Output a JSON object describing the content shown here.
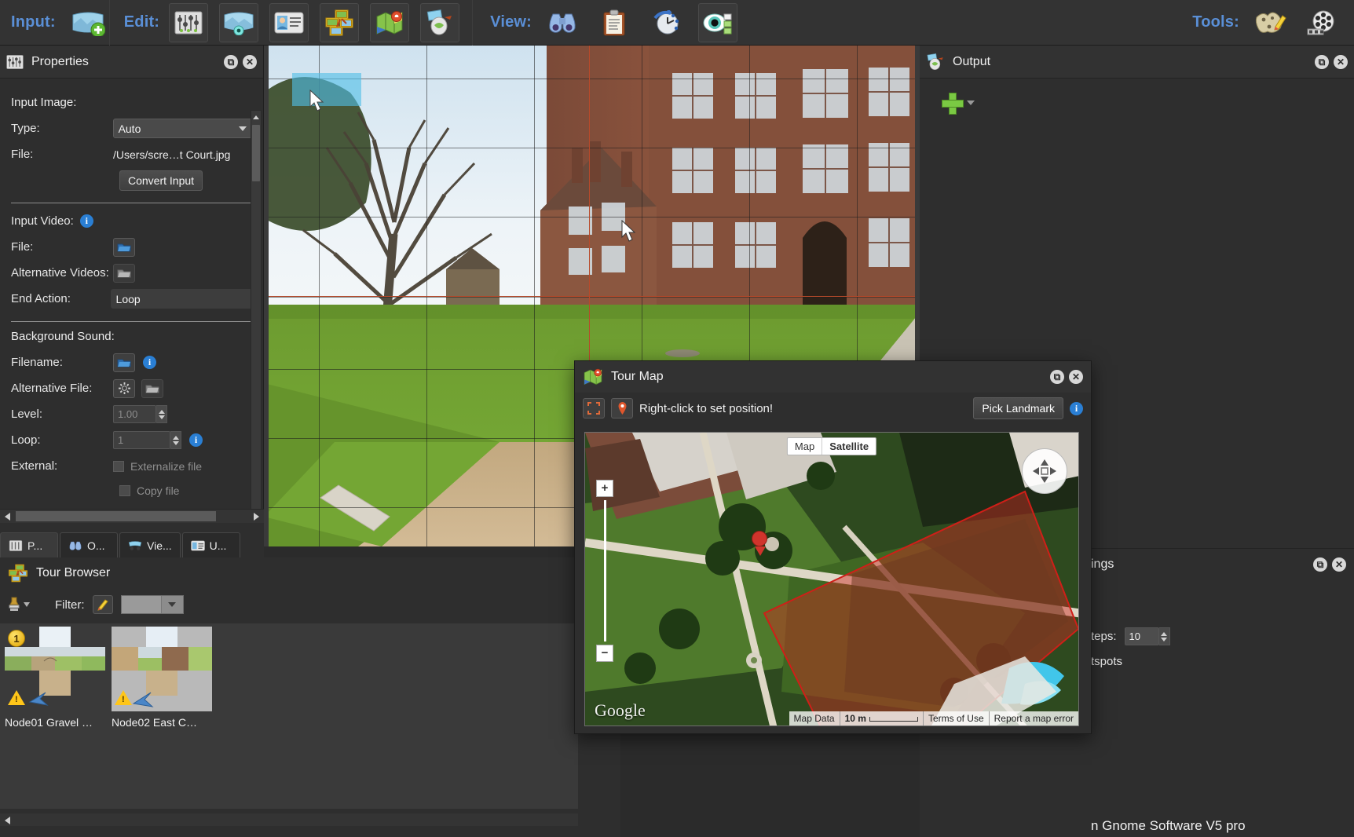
{
  "toolbar": {
    "input_label": "Input:",
    "edit_label": "Edit:",
    "view_label": "View:",
    "tools_label": "Tools:",
    "input_buttons": [
      {
        "name": "add-input-panorama-icon",
        "glyph": "🏞"
      }
    ],
    "edit_buttons": [
      {
        "name": "properties-sliders-icon",
        "glyph": "🎚"
      },
      {
        "name": "panorama-viewer-icon",
        "glyph": "🌅"
      },
      {
        "name": "user-data-card-icon",
        "glyph": "📇"
      },
      {
        "name": "tour-browser-icon",
        "glyph": "🖼"
      },
      {
        "name": "tour-map-icon",
        "glyph": "🗺"
      },
      {
        "name": "output-tree-icon",
        "glyph": "🌳"
      }
    ],
    "view_buttons": [
      {
        "name": "binoculars-icon",
        "glyph": "🔭"
      },
      {
        "name": "clipboard-icon",
        "glyph": "📋"
      },
      {
        "name": "history-clock-icon",
        "glyph": "🕓"
      },
      {
        "name": "preview-eye-icon",
        "glyph": "👁"
      }
    ],
    "tools_buttons": [
      {
        "name": "map-edit-icon",
        "glyph": "🗺"
      },
      {
        "name": "film-reel-icon",
        "glyph": "🎥"
      }
    ]
  },
  "properties": {
    "title": "Properties",
    "restore_label": "⧉",
    "close_label": "✕",
    "groups": {
      "input_image": {
        "heading": "Input Image:",
        "type_label": "Type:",
        "type_value": "Auto",
        "file_label": "File:",
        "file_value": "/Users/scre…t Court.jpg",
        "convert_button": "Convert Input"
      },
      "input_video": {
        "heading": "Input Video:",
        "file_label": "File:",
        "alt_videos_label": "Alternative Videos:",
        "end_action_label": "End Action:",
        "end_action_value": "Loop"
      },
      "background_sound": {
        "heading": "Background Sound:",
        "filename_label": "Filename:",
        "alt_file_label": "Alternative File:",
        "level_label": "Level:",
        "level_value": "1.00",
        "loop_label": "Loop:",
        "loop_value": "1",
        "external_label": "External:",
        "externalize_checkbox": "Externalize file",
        "copy_checkbox": "Copy file"
      }
    },
    "tabs": [
      {
        "label": "P...",
        "icon": "properties-sliders-icon",
        "active": true
      },
      {
        "label": "O...",
        "icon": "binoculars-icon",
        "active": false
      },
      {
        "label": "Vie...",
        "icon": "viewer-icon",
        "active": false
      },
      {
        "label": "U...",
        "icon": "user-data-card-icon",
        "active": false
      }
    ]
  },
  "tour_browser": {
    "title": "Tour Browser",
    "filter_label": "Filter:",
    "filter_value": "",
    "nodes": [
      {
        "number": "1",
        "caption": "Node01 Gravel …",
        "selected": false,
        "warning": true
      },
      {
        "number": "",
        "caption": "Node02 East C…",
        "selected": true,
        "warning": true
      }
    ]
  },
  "viewport": {
    "image_description": "Panoramic photo of a red-brick Tudor manor house with lawn and gravel path",
    "hotspot_name": "panorama-hotspot"
  },
  "output": {
    "title": "Output",
    "add_label": "+",
    "restore_label": "⧉",
    "close_label": "✕"
  },
  "settings_panel": {
    "title_visible": "ings",
    "steps_label": "teps:",
    "steps_value": "10",
    "hotspots_label": "tspots",
    "footer_text": "n Gnome Software V5 pro",
    "restore_label": "⧉",
    "close_label": "✕"
  },
  "tour_map": {
    "title": "Tour Map",
    "restore_label": "⧉",
    "close_label": "✕",
    "fullscreen_icon": "expand-icon",
    "pin_icon": "map-pin-icon",
    "hint": "Right-click to set position!",
    "pick_landmark_button": "Pick Landmark",
    "map": {
      "type_map_label": "Map",
      "type_satellite_label": "Satellite",
      "active_type": "Satellite",
      "zoom_in_label": "+",
      "zoom_out_label": "−",
      "watermark": "Google",
      "footer": {
        "map_data": "Map Data",
        "scale": "10 m",
        "terms": "Terms of Use",
        "report": "Report a map error"
      }
    }
  },
  "colors": {
    "accent_blue": "#5a8fd6",
    "panel_bg": "#2e2e2e",
    "toolbar_bg": "#333333",
    "info_blue": "#2a7fd4",
    "warning_yellow": "#ffc619",
    "map_polygon_red": "#d0342c",
    "add_green": "#7ac943"
  }
}
